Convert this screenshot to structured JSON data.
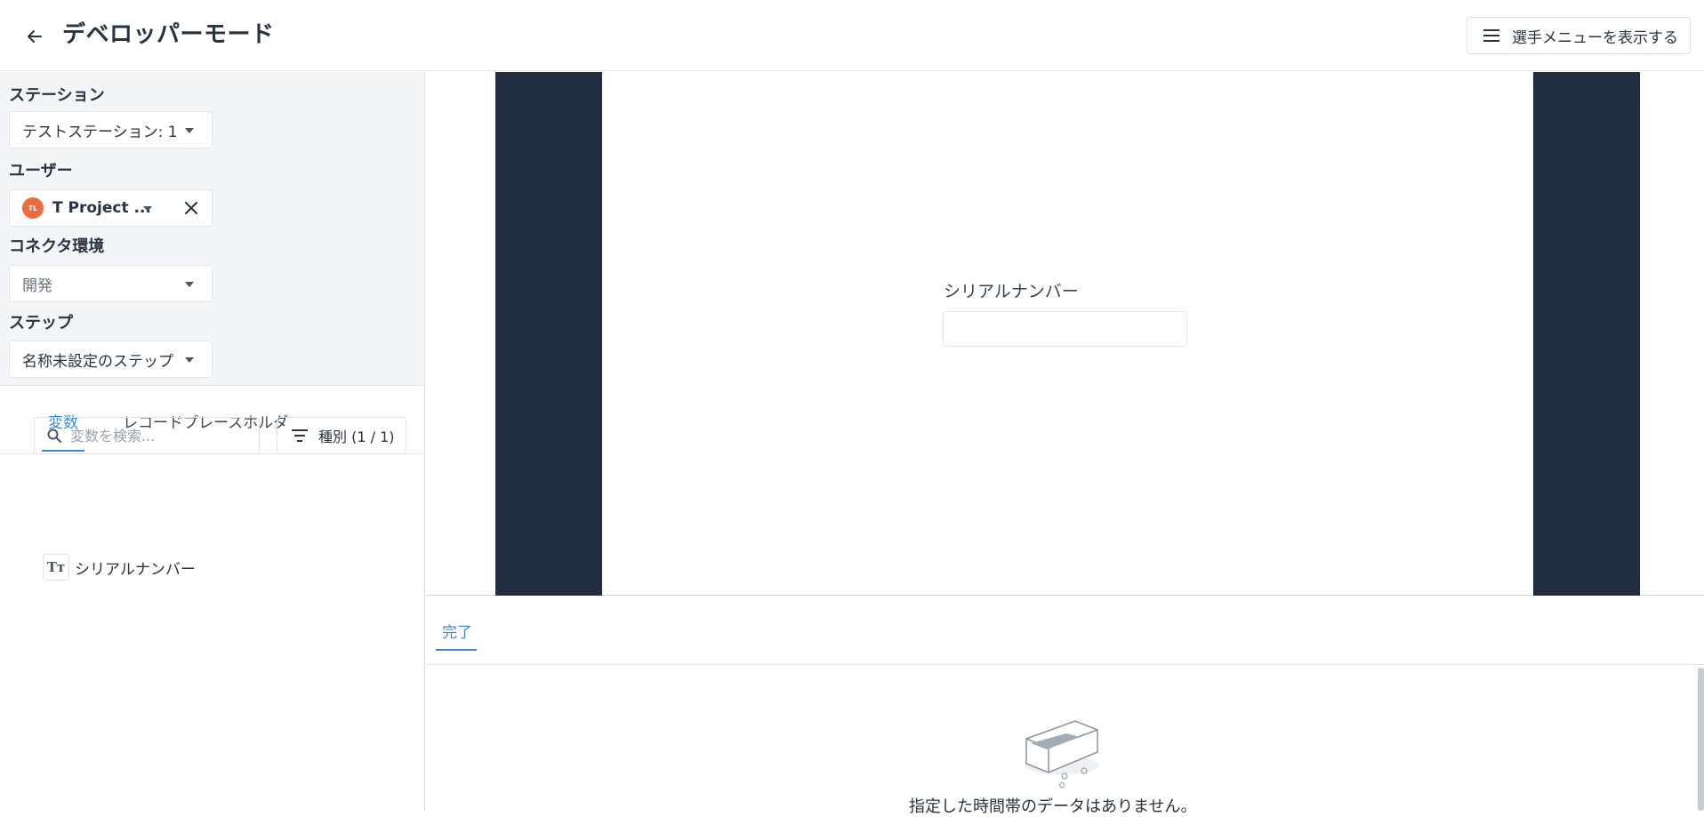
{
  "header": {
    "title": "デベロッパーモード",
    "menu_button_label": "選手メニューを表示する"
  },
  "config": {
    "station": {
      "label": "ステーション",
      "value": "テストステーション: 1"
    },
    "user": {
      "label": "ユーザー",
      "avatar_initials": "TL",
      "value": "T Project ..."
    },
    "connector": {
      "label": "コネクタ環境",
      "value": "開発"
    },
    "step": {
      "label": "ステップ",
      "value": "名称未設定のステップ"
    }
  },
  "tabs": [
    {
      "label": "変数",
      "active": true
    },
    {
      "label": "レコードプレースホルダ",
      "active": false
    }
  ],
  "search": {
    "placeholder": "変数を検索..."
  },
  "filter": {
    "label": "種別 (1 / 1)"
  },
  "variables": [
    {
      "type_icon": "Tт",
      "name": "シリアルナンバー"
    }
  ],
  "preview": {
    "field_label": "シリアルナンバー",
    "field_value": ""
  },
  "bottom": {
    "tab_label": "完了",
    "empty_message": "指定した時間帯のデータはありません。"
  },
  "colors": {
    "accent": "#3b8ad1",
    "dark_bar": "#222d42",
    "panel_bg": "#f4f5f7",
    "avatar": "#f06a3d"
  }
}
